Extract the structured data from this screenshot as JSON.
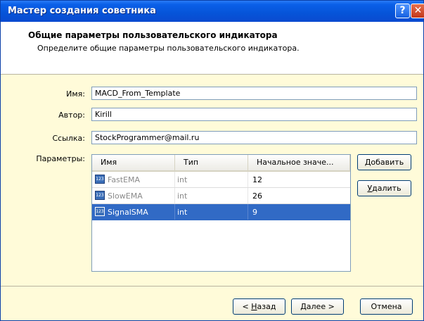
{
  "window": {
    "title": "Мастер создания советника",
    "help_label": "?",
    "close_label": "✕"
  },
  "header": {
    "title": "Общие параметры пользовательского индикатора",
    "subtitle": "Определите общие параметры пользовательского индикатора."
  },
  "form": {
    "name_label": "Имя:",
    "name_value": "MACD_From_Template",
    "author_label": "Автор:",
    "author_value": "Kirill",
    "link_label": "Ссылка:",
    "link_value": "StockProgrammer@mail.ru",
    "params_label": "Параметры:"
  },
  "params_table": {
    "columns": [
      "Имя",
      "Тип",
      "Начальное значе..."
    ],
    "rows": [
      {
        "name": "FastEMA",
        "type": "int",
        "value": "12",
        "icon": "param-icon"
      },
      {
        "name": "SlowEMA",
        "type": "int",
        "value": "26",
        "icon": "param-icon"
      },
      {
        "name": "SignalSMA",
        "type": "int",
        "value": "9",
        "icon": "param-icon"
      }
    ],
    "icon_text": "123"
  },
  "buttons": {
    "add": {
      "u": "Д",
      "rest": "обавить"
    },
    "remove": {
      "u": "У",
      "rest": "далить"
    },
    "back": {
      "pre": "< ",
      "u": "Н",
      "rest": "азад"
    },
    "next": {
      "u": "Д",
      "rest": "алее >"
    },
    "cancel": "Отмена"
  },
  "colors": {
    "titlebar": "#0654d8",
    "body": "#fffbd9",
    "selection": "#316ac5"
  }
}
